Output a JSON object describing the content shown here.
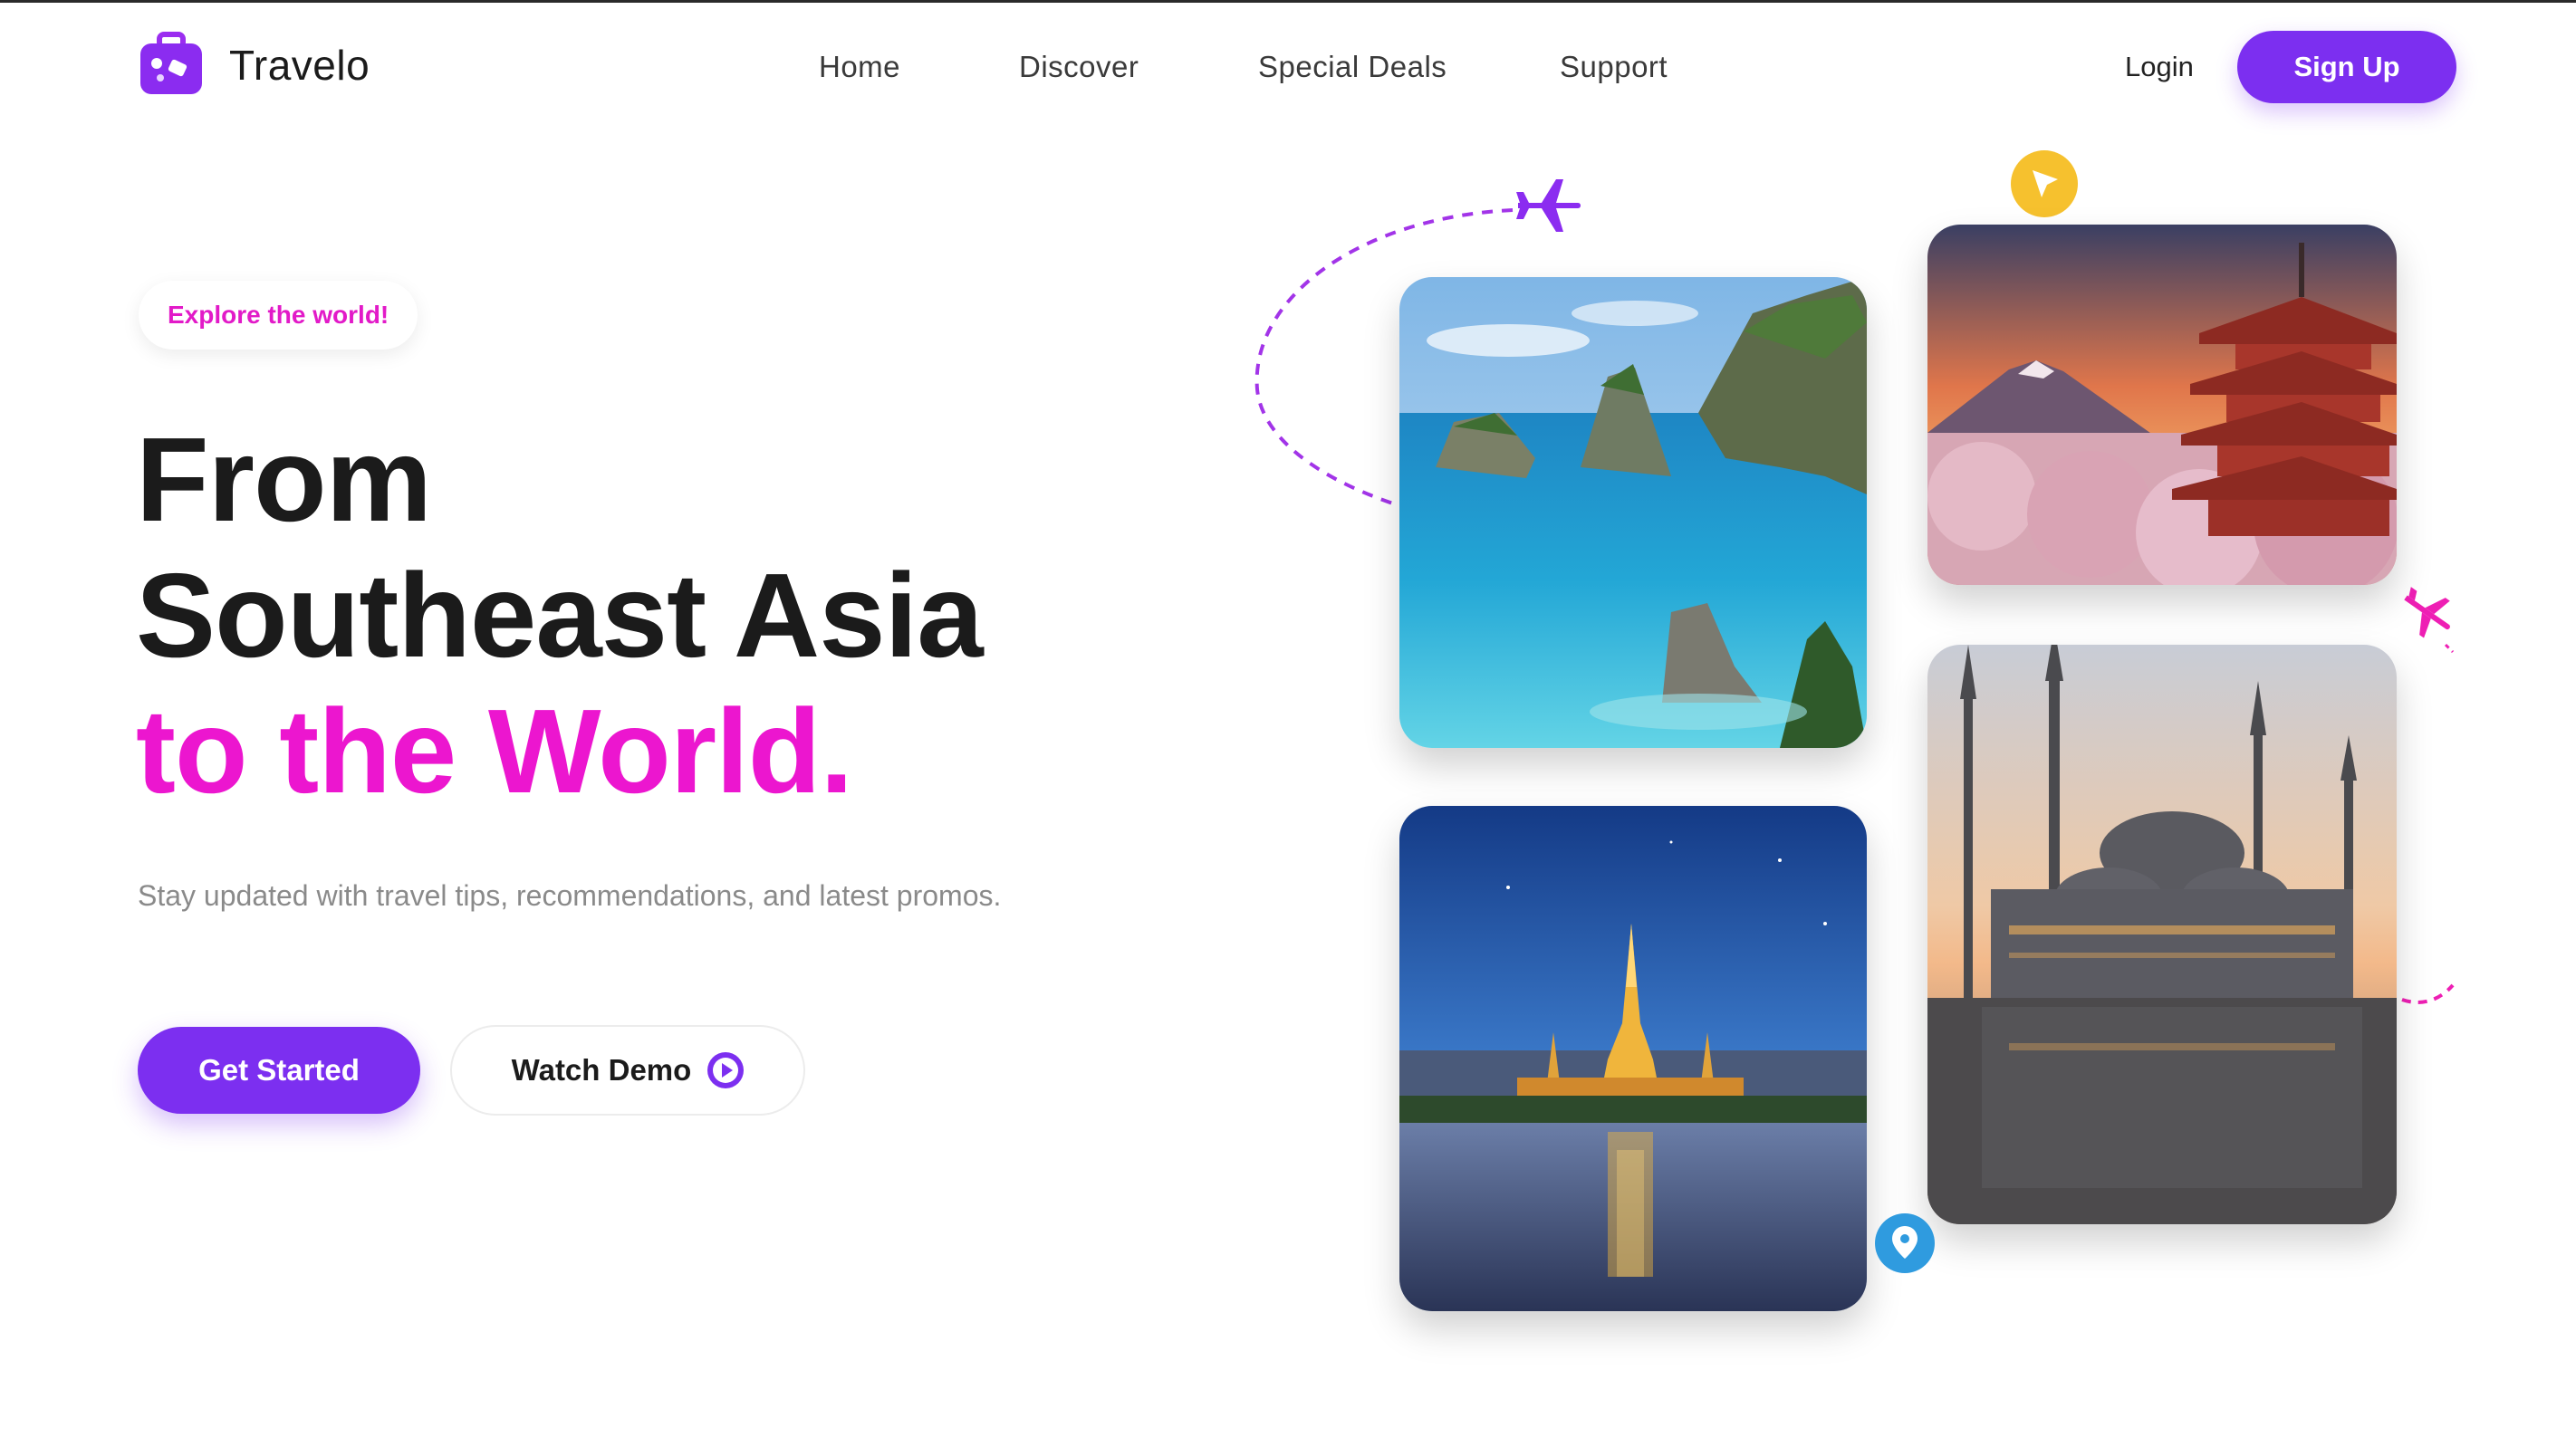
{
  "brand": {
    "name": "Travelo",
    "icon": "suitcase-icon",
    "accent": "#7c2ff0",
    "highlight": "#ec16cf"
  },
  "nav": {
    "items": [
      {
        "label": "Home"
      },
      {
        "label": "Discover"
      },
      {
        "label": "Special Deals"
      },
      {
        "label": "Support"
      }
    ]
  },
  "auth": {
    "login_label": "Login",
    "signup_label": "Sign Up"
  },
  "hero": {
    "tag": "Explore the world!",
    "headline_line1": "From",
    "headline_line2": "Southeast Asia",
    "headline_line3": "to the World.",
    "subtext": "Stay updated with travel tips, recommendations, and latest promos.",
    "cta_primary": "Get Started",
    "cta_secondary": "Watch Demo"
  },
  "gallery": {
    "images": [
      {
        "name": "island-cliffs-photo"
      },
      {
        "name": "pagoda-mount-fuji-photo"
      },
      {
        "name": "thai-temple-river-photo"
      },
      {
        "name": "blue-mosque-photo"
      }
    ],
    "icons": [
      "airplane-icon",
      "cursor-badge-icon",
      "location-pin-icon"
    ]
  }
}
